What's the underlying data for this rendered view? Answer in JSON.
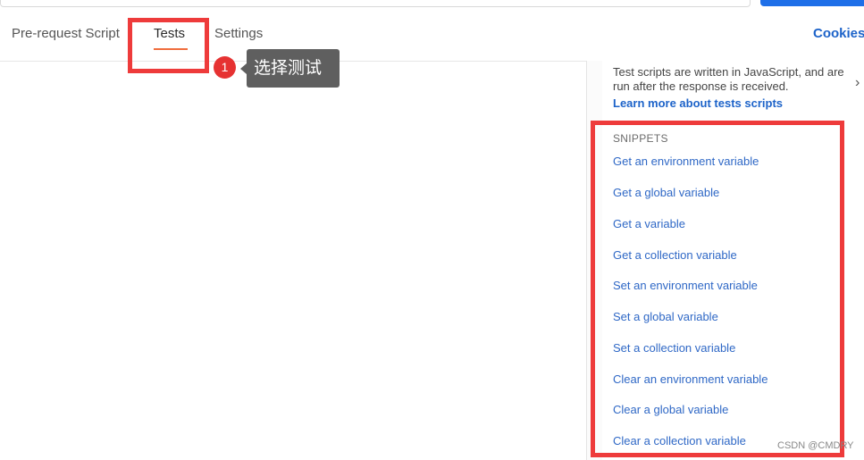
{
  "tabs": {
    "pre_request": "Pre-request Script",
    "tests": "Tests",
    "settings": "Settings"
  },
  "cookies_label": "Cookies",
  "annotation": {
    "number": "1",
    "text": "选择测试"
  },
  "help": {
    "text": "Test scripts are written in JavaScript, and are run after the response is received.",
    "link": "Learn more about tests scripts"
  },
  "snippets": {
    "title": "SNIPPETS",
    "items": [
      "Get an environment variable",
      "Get a global variable",
      "Get a variable",
      "Get a collection variable",
      "Set an environment variable",
      "Set a global variable",
      "Set a collection variable",
      "Clear an environment variable",
      "Clear a global variable",
      "Clear a collection variable"
    ]
  },
  "watermark": "CSDN @CMDRY",
  "colors": {
    "accent": "#1d63c9",
    "tab_underline": "#f06d3d",
    "highlight": "#ee3b3b"
  },
  "icons": [
    "chevron-right-icon"
  ]
}
